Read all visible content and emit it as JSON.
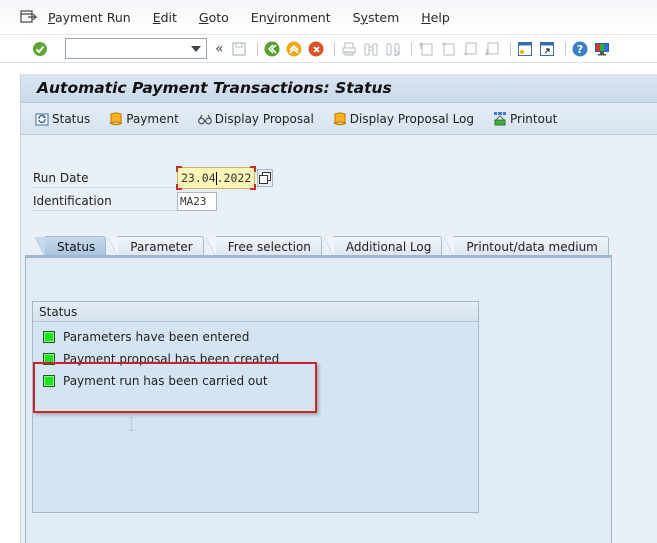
{
  "menubar": {
    "items": [
      {
        "label": "Payment Run",
        "mnemonic": "P"
      },
      {
        "label": "Edit",
        "mnemonic": "E"
      },
      {
        "label": "Goto",
        "mnemonic": "G"
      },
      {
        "label": "Environment",
        "mnemonic": "v"
      },
      {
        "label": "System",
        "mnemonic": "y"
      },
      {
        "label": "Help",
        "mnemonic": "H"
      }
    ]
  },
  "toolbar": {
    "command_field_value": "",
    "icons": [
      "enter-icon",
      "save-icon",
      "back-icon",
      "exit-icon",
      "cancel-icon",
      "print-icon",
      "find-icon",
      "find-next-icon",
      "first-page-icon",
      "previous-page-icon",
      "next-page-icon",
      "last-page-icon",
      "new-session-icon",
      "shortcut-icon",
      "help-icon",
      "customize-layout-icon"
    ]
  },
  "title": "Automatic Payment Transactions: Status",
  "app_toolbar": {
    "buttons": [
      {
        "label": "Status",
        "icon": "refresh-icon"
      },
      {
        "label": "Payment",
        "icon": "scroll-icon"
      },
      {
        "label": "Display Proposal",
        "icon": "glasses-icon"
      },
      {
        "label": "Display Proposal Log",
        "icon": "scroll-icon"
      },
      {
        "label": "Printout",
        "icon": "printout-icon"
      }
    ]
  },
  "fields": {
    "run_date": {
      "label": "Run Date",
      "value": "23.04.2022"
    },
    "identification": {
      "label": "Identification",
      "value": "MA23"
    }
  },
  "tabs": [
    {
      "label": "Status",
      "active": true
    },
    {
      "label": "Parameter",
      "active": false
    },
    {
      "label": "Free selection",
      "active": false
    },
    {
      "label": "Additional Log",
      "active": false
    },
    {
      "label": "Printout/data medium",
      "active": false
    }
  ],
  "status_group": {
    "title": "Status",
    "items": [
      {
        "label": "Parameters have been entered",
        "status": "green"
      },
      {
        "label": "Payment proposal has been created",
        "status": "green"
      },
      {
        "label": "Payment run has been carried out",
        "status": "green"
      }
    ]
  },
  "colors": {
    "led_green": "#22e022",
    "highlight_red": "#c5242c",
    "date_field_bg": "#fdf5b8"
  }
}
